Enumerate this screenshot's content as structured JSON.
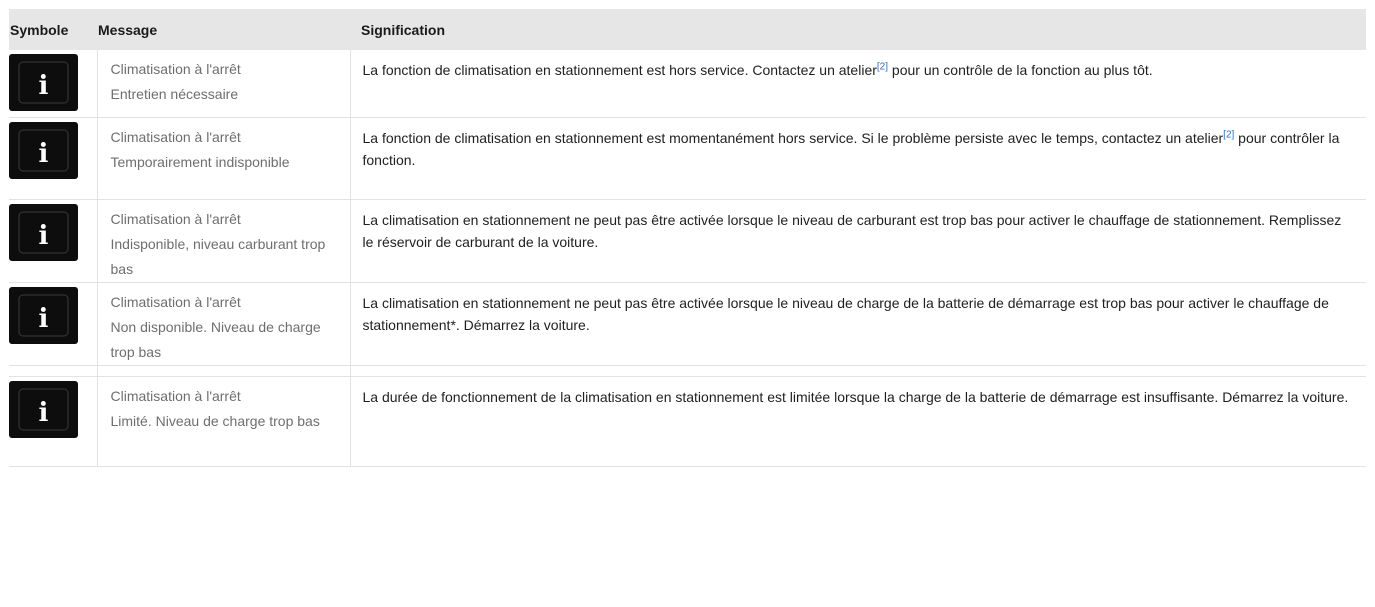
{
  "table": {
    "headers": {
      "symbol": "Symbole",
      "message": "Message",
      "meaning": "Signification"
    },
    "rows": [
      {
        "icon": "info-icon",
        "message_line1": "Climatisation à l'arrêt",
        "message_line2": "Entretien nécessaire",
        "meaning_before": "La fonction de climatisation en stationnement est hors service. Contactez un atelier",
        "footnote": "[2]",
        "meaning_after": " pour un contrôle de la fonction au plus tôt."
      },
      {
        "icon": "info-icon",
        "message_line1": "Climatisation à l'arrêt",
        "message_line2": "Temporairement indisponible",
        "meaning_before": "La fonction de climatisation en stationnement est momentanément hors service. Si le problème persiste avec le temps, contactez un atelier",
        "footnote": "[2]",
        "meaning_after": " pour contrôler la fonction."
      },
      {
        "icon": "info-icon",
        "message_line1": "Climatisation à l'arrêt",
        "message_line2": "Indisponible, niveau carburant trop bas",
        "meaning": "La climatisation en stationnement ne peut pas être activée lorsque le niveau de carburant est trop bas pour activer le chauffage de stationnement. Remplissez le réservoir de carburant de la voiture."
      },
      {
        "icon": "info-icon",
        "message_line1": "Climatisation à l'arrêt",
        "message_line2": "Non disponible. Niveau de charge trop bas",
        "meaning": "La climatisation en stationnement ne peut pas être activée lorsque le niveau de charge de la batterie de démarrage est trop bas pour activer le chauffage de stationnement*. Démarrez la voiture."
      },
      {
        "icon": "info-icon",
        "message_line1": "Climatisation à l'arrêt",
        "message_line2": "Limité. Niveau de charge trop bas",
        "meaning": "La durée de fonctionnement de la climatisation en stationnement est limitée lorsque la charge de la batterie de démarrage est insuffisante. Démarrez la voiture."
      }
    ]
  },
  "colors": {
    "header_bg": "#e6e6e6",
    "icon_bg": "#0d0d0d",
    "message_text": "#6e6e6e",
    "footnote_link": "#2e6fbf"
  }
}
